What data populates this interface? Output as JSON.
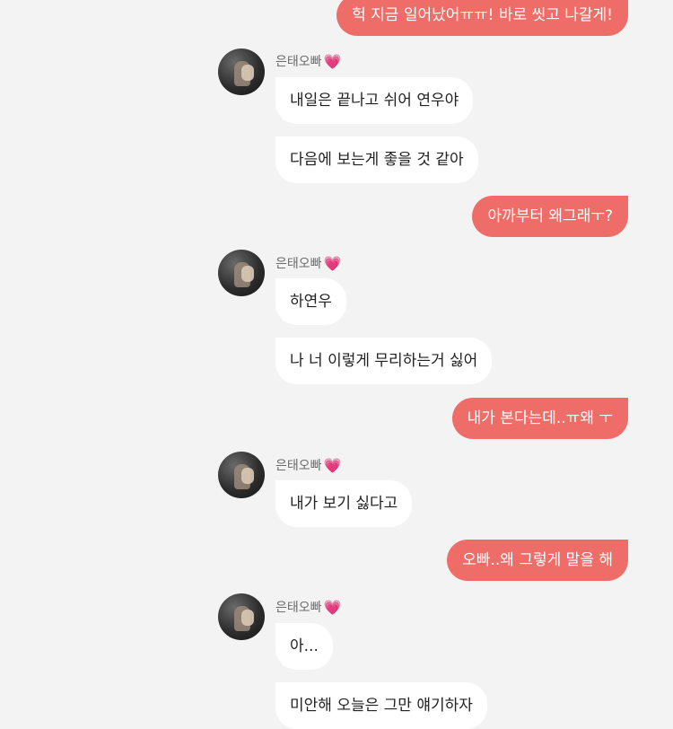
{
  "sender_name": "은태오빠",
  "heart_glyph": "💗",
  "colors": {
    "mine_bubble": "#ef6d69",
    "their_bubble": "#ffffff",
    "background": "#f3f3f3"
  },
  "messages": [
    {
      "from": "me",
      "text": "헉 지금 일어났어ㅠㅠ! 바로 씻고 나갈게!"
    },
    {
      "from": "them",
      "text": "내일은 끝나고 쉬어 연우야"
    },
    {
      "from": "them",
      "text": "다음에 보는게 좋을 것 같아"
    },
    {
      "from": "me",
      "text": "아까부터 왜그래ㅜ?"
    },
    {
      "from": "them",
      "text": "하연우"
    },
    {
      "from": "them",
      "text": "나 너 이렇게 무리하는거 싫어"
    },
    {
      "from": "me",
      "text": "내가 본다는데..ㅠ왜 ㅜ"
    },
    {
      "from": "them",
      "text": "내가 보기 싫다고"
    },
    {
      "from": "me",
      "text": "오빠..왜 그렇게 말을 해"
    },
    {
      "from": "them",
      "text": "아..."
    },
    {
      "from": "them",
      "text": "미안해 오늘은 그만 얘기하자"
    }
  ]
}
